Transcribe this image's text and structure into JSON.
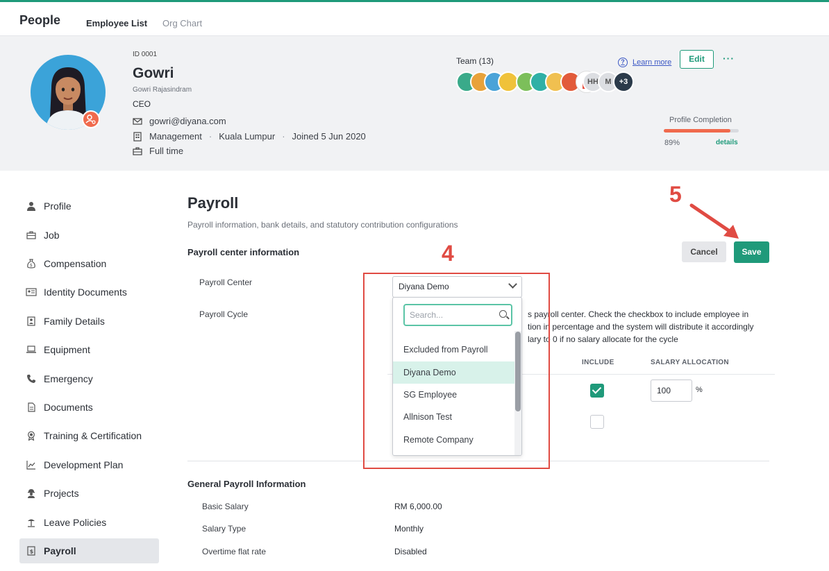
{
  "app": {
    "title": "People",
    "tabs": [
      "Employee List",
      "Org Chart"
    ]
  },
  "profile": {
    "id": "ID 0001",
    "name": "Gowri",
    "full_name": "Gowri Rajasindram",
    "title": "CEO",
    "email": "gowri@diyana.com",
    "department": "Management",
    "location": "Kuala Lumpur",
    "joined": "Joined 5 Jun 2020",
    "employment_type": "Full time"
  },
  "team": {
    "label": "Team (13)",
    "initials": [
      "HH",
      "M"
    ],
    "more": "+3"
  },
  "help": {
    "learn_more": "Learn more"
  },
  "actions": {
    "edit": "Edit",
    "more": "···"
  },
  "completion": {
    "label": "Profile Completion",
    "percent_text": "89%",
    "percent_value": 0.89,
    "details": "details"
  },
  "sidebar": {
    "items": [
      {
        "label": "Profile",
        "icon": "person-icon"
      },
      {
        "label": "Job",
        "icon": "briefcase-icon"
      },
      {
        "label": "Compensation",
        "icon": "money-bag-icon"
      },
      {
        "label": "Identity Documents",
        "icon": "id-card-icon"
      },
      {
        "label": "Family Details",
        "icon": "family-icon"
      },
      {
        "label": "Equipment",
        "icon": "laptop-icon"
      },
      {
        "label": "Emergency",
        "icon": "phone-icon"
      },
      {
        "label": "Documents",
        "icon": "document-icon"
      },
      {
        "label": "Training & Certification",
        "icon": "award-icon"
      },
      {
        "label": "Development Plan",
        "icon": "chart-icon"
      },
      {
        "label": "Projects",
        "icon": "worker-icon"
      },
      {
        "label": "Leave Policies",
        "icon": "beach-icon"
      },
      {
        "label": "Payroll",
        "icon": "payroll-icon",
        "active": true
      }
    ]
  },
  "payroll": {
    "title": "Payroll",
    "subtitle": "Payroll information, bank details, and statutory contribution configurations",
    "section_title": "Payroll center information",
    "cancel": "Cancel",
    "save": "Save",
    "center_label": "Payroll Center",
    "center_value": "Diyana Demo",
    "cycle_label": "Payroll Cycle",
    "cycle_text_1": "s payroll center. Check the checkbox to include employee in",
    "cycle_text_2": "tion in percentage and the system will distribute it accordingly",
    "cycle_text_3": "lary to 0 if no salary allocate for the cycle",
    "col_include": "INCLUDE",
    "col_allocation": "SALARY ALLOCATION",
    "allocation_value": "100",
    "percent_sign": "%"
  },
  "dropdown_menu": {
    "search_placeholder": "Search...",
    "options": [
      "Excluded from Payroll",
      "Diyana Demo",
      "SG Employee",
      "Allnison Test",
      "Remote Company"
    ],
    "selected": "Diyana Demo"
  },
  "general": {
    "title": "General Payroll Information",
    "rows": [
      {
        "label": "Basic Salary",
        "value": "RM 6,000.00"
      },
      {
        "label": "Salary Type",
        "value": "Monthly"
      },
      {
        "label": "Overtime flat rate",
        "value": "Disabled"
      }
    ]
  },
  "annotations": {
    "step4": "4",
    "step5": "5"
  },
  "colors": {
    "accent": "#1f9a7a",
    "annotation": "#e04b43",
    "badge": "#f06a4d"
  }
}
